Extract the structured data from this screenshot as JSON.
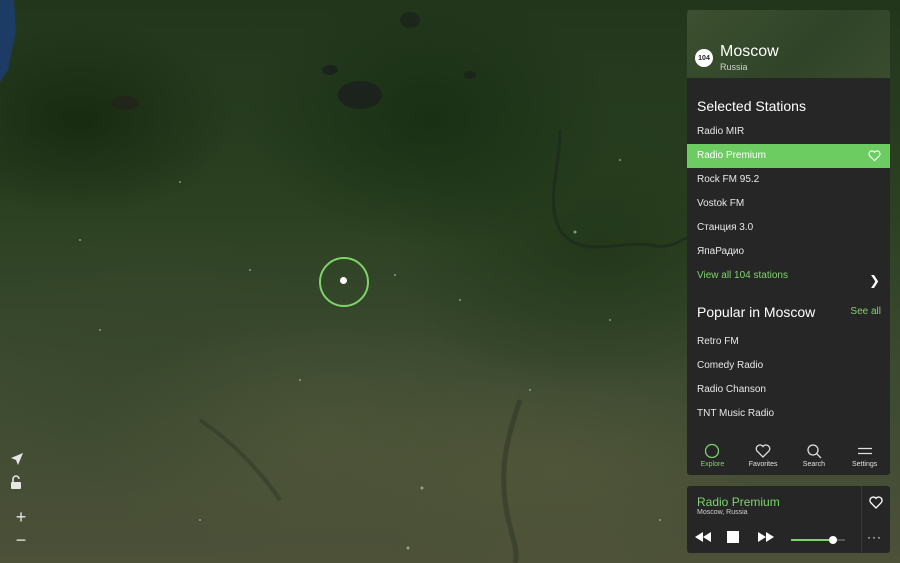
{
  "map": {
    "controls": [
      "navigation-arrow-icon",
      "lock-open-icon",
      "zoom-in",
      "zoom-out"
    ],
    "zoom_in_label": "+",
    "zoom_out_label": "−",
    "pin_color": "#7ed36b"
  },
  "city": {
    "station_count_badge": "104",
    "name": "Moscow",
    "country": "Russia"
  },
  "selected": {
    "title": "Selected Stations",
    "stations": [
      "Radio MIR",
      "Radio Premium",
      "Rock FM 95.2",
      "Vostok FM",
      "Станция 3.0",
      "ЯпаРадио"
    ],
    "active_index": 1,
    "view_all": "View all 104 stations"
  },
  "popular": {
    "title": "Popular in Moscow",
    "see_all": "See all",
    "stations": [
      "Retro FM",
      "Comedy Radio",
      "Radio Chanson",
      "TNT Music Radio"
    ]
  },
  "tabs": [
    {
      "label": "Explore",
      "icon": "circle-icon",
      "active": true
    },
    {
      "label": "Favorites",
      "icon": "heart-icon",
      "active": false
    },
    {
      "label": "Search",
      "icon": "search-icon",
      "active": false
    },
    {
      "label": "Settings",
      "icon": "menu-lines-icon",
      "active": false
    }
  ],
  "player": {
    "title": "Radio Premium",
    "subtitle": "Moscow, Russia",
    "volume": 0.78,
    "more_label": "···"
  },
  "colors": {
    "accent": "#7fd36e",
    "panel": "#262626",
    "active_row": "#6ccc62"
  }
}
